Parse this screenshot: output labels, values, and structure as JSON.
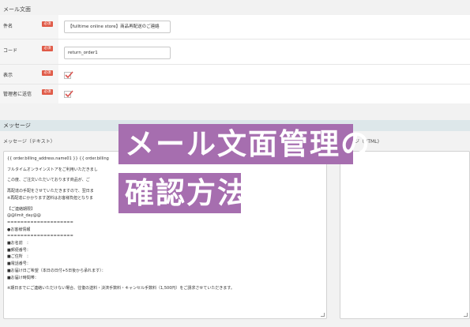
{
  "mail_section": {
    "title": "メール文面",
    "rows": {
      "subject_label": "件名",
      "code_label": "コード",
      "display_label": "表示",
      "send_admin_label": "管理者に送信"
    },
    "required_badge": "必須",
    "subject_value": "【fulltime online store】商品再配送のご連絡",
    "code_value": "return_order1",
    "display_checked": true,
    "send_admin_checked": true
  },
  "message_section": {
    "title": "メッセージ",
    "text_panel_title": "メッセージ（テキスト）",
    "html_panel_title": "ージ（HTML)",
    "lines": [
      "{{ order.billing_address.name01 }} {{ order.billing",
      "フルタイムオンラインストアをご利用いただきまし",
      "この度、ご注文いただいております商品が、ご",
      "再配達の手配をさせていただきますので、翌日ま",
      "※再配達にかかります送料はお客様負担となりま",
      "【ご連絡期限】",
      "@@limit_day@@",
      "====================",
      "●お客様情報",
      "====================",
      "■お名前　：",
      "■郵便番号：",
      "■ご住所　：",
      "■電話番号：",
      "■お届け日ご希望（本日の日付+5日後から承れます）：",
      "■お届け時間帯：",
      "※期日までにご連絡いただけない場合、往復の送料・決済手数料・キャンセル手数料（1,500円）をご請求させていただきます。"
    ]
  },
  "overlay": {
    "line1": "メール文面管理の",
    "line2": "確認方法",
    "color": "#a66eaf"
  },
  "colors": {
    "required_badge": "#e05a47",
    "section_bar": "#dde7ea",
    "checkmark": "#d9534f"
  }
}
